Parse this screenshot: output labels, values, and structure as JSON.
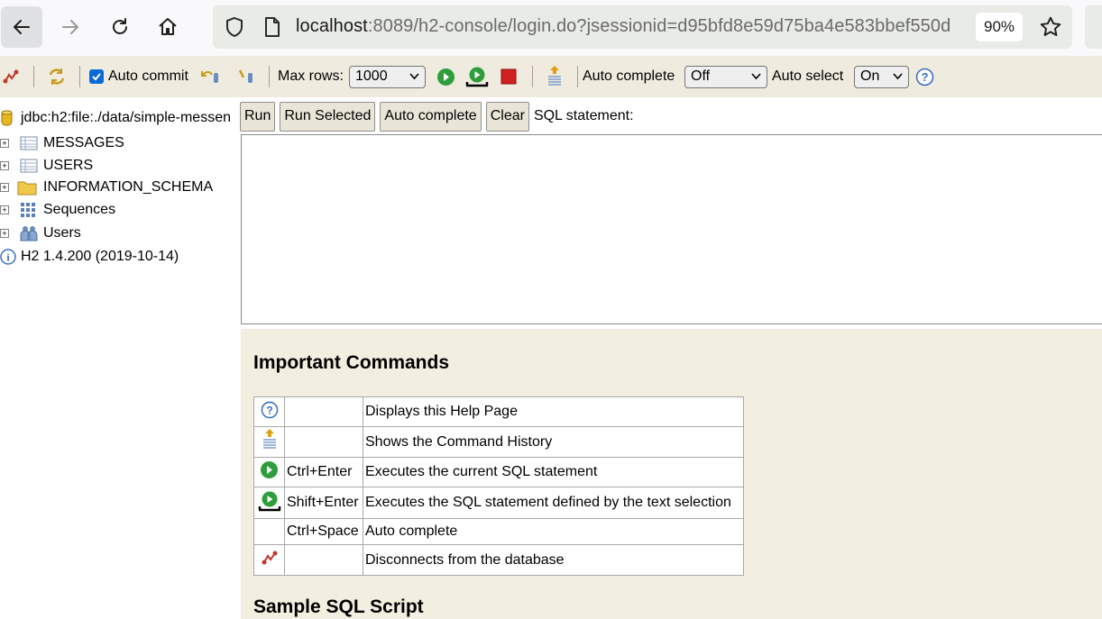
{
  "browser": {
    "url_host": "localhost",
    "url_rest": ":8089/h2-console/login.do?jsessionid=d95bfd8e59d75ba4e583bbef550d",
    "zoom": "90%",
    "icons": [
      "back-arrow-icon",
      "forward-arrow-icon",
      "reload-icon",
      "home-icon",
      "shield-icon",
      "page-icon",
      "bookmark-star-icon"
    ]
  },
  "toolbar": {
    "auto_commit_label": "Auto commit",
    "auto_commit_checked": true,
    "max_rows_label": "Max rows:",
    "max_rows_value": "1000",
    "auto_complete_label": "Auto complete",
    "auto_complete_value": "Off",
    "auto_select_label": "Auto select",
    "auto_select_value": "On"
  },
  "tree": {
    "connection": "jdbc:h2:file:./data/simple-messen",
    "items": [
      {
        "label": "MESSAGES",
        "icon": "table-icon"
      },
      {
        "label": "USERS",
        "icon": "table-icon"
      },
      {
        "label": "INFORMATION_SCHEMA",
        "icon": "folder-icon"
      },
      {
        "label": "Sequences",
        "icon": "sequence-icon"
      },
      {
        "label": "Users",
        "icon": "users-icon"
      }
    ],
    "version": "H2 1.4.200 (2019-10-14)"
  },
  "sql": {
    "run": "Run",
    "run_selected": "Run Selected",
    "auto_complete": "Auto complete",
    "clear": "Clear",
    "statement_label": "SQL statement:",
    "statement_value": ""
  },
  "help": {
    "title": "Important Commands",
    "commands": [
      {
        "icon": "help-icon",
        "key": "",
        "desc": "Displays this Help Page"
      },
      {
        "icon": "history-icon",
        "key": "",
        "desc": "Shows the Command History"
      },
      {
        "icon": "run-icon",
        "key": "Ctrl+Enter",
        "desc": "Executes the current SQL statement"
      },
      {
        "icon": "run-selected-icon",
        "key": "Shift+Enter",
        "desc": "Executes the SQL statement defined by the text selection"
      },
      {
        "icon": "",
        "key": "Ctrl+Space",
        "desc": "Auto complete"
      },
      {
        "icon": "disconnect-icon",
        "key": "",
        "desc": "Disconnects from the database"
      }
    ],
    "sample_title": "Sample SQL Script"
  }
}
